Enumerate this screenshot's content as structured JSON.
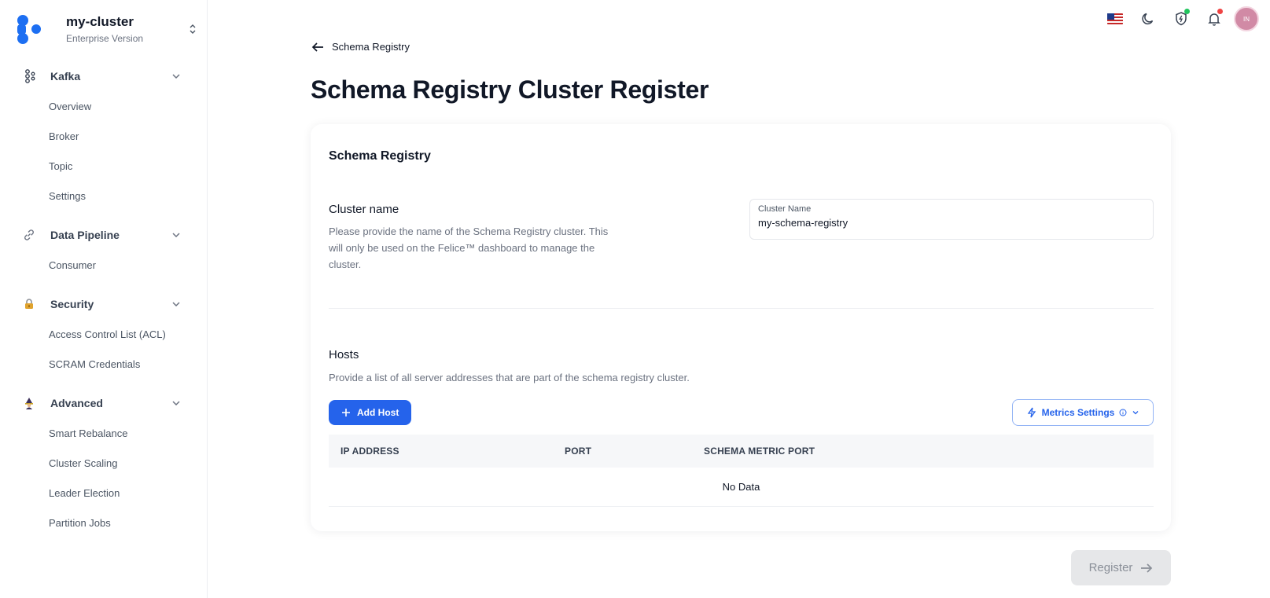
{
  "brand": {
    "title": "my-cluster",
    "subtitle": "Enterprise Version"
  },
  "sidebar": {
    "groups": [
      {
        "label": "Kafka",
        "icon": "kafka-icon",
        "items": [
          "Overview",
          "Broker",
          "Topic",
          "Settings"
        ]
      },
      {
        "label": "Data Pipeline",
        "icon": "link-icon",
        "items": [
          "Consumer"
        ]
      },
      {
        "label": "Security",
        "icon": "lock-icon",
        "items": [
          "Access Control List (ACL)",
          "SCRAM Credentials"
        ]
      },
      {
        "label": "Advanced",
        "icon": "wizard-icon",
        "items": [
          "Smart Rebalance",
          "Cluster Scaling",
          "Leader Election",
          "Partition Jobs"
        ]
      }
    ]
  },
  "topbar": {
    "avatar_initials": "IN",
    "icons": [
      "us-flag-icon",
      "moon-icon",
      "shield-icon",
      "bell-icon"
    ],
    "status_colors": {
      "shield": "#22c55e",
      "bell": "#ef4444"
    }
  },
  "header": {
    "back_label": "Schema Registry",
    "title": "Schema Registry Cluster Register"
  },
  "card": {
    "title": "Schema Registry",
    "cluster": {
      "title": "Cluster name",
      "description_line1": "Please provide the name of the Schema Registry cluster. This",
      "description_line2": "will only be used on the Felice™ dashboard to manage the",
      "description_line3": "cluster.",
      "field_label": "Cluster Name",
      "field_value": "my-schema-registry"
    },
    "hosts": {
      "title": "Hosts",
      "description": "Provide a list of all server addresses that are part of the schema registry cluster.",
      "add_label": "Add Host",
      "metrics_label": "Metrics Settings",
      "columns": [
        "IP ADDRESS",
        "PORT",
        "SCHEMA METRIC PORT"
      ],
      "empty_text": "No Data"
    }
  },
  "register_label": "Register",
  "colors": {
    "accent": "#2563eb",
    "disabled_bg": "#e6e7e9"
  }
}
